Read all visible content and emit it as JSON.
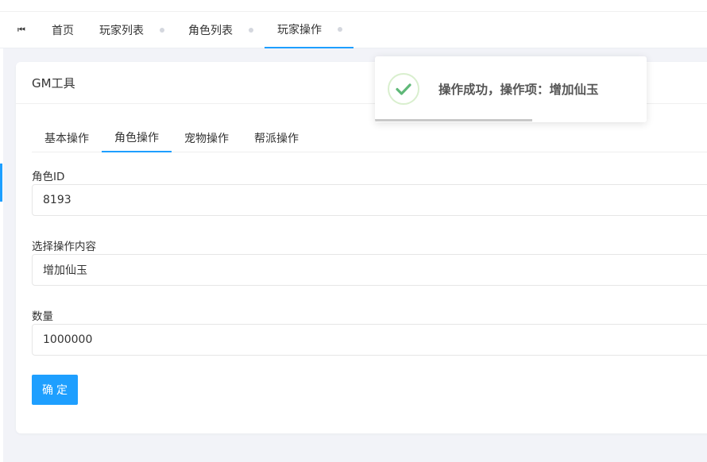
{
  "nav": {
    "first_icon": "⏮",
    "tabs": [
      {
        "label": "首页",
        "closable": false
      },
      {
        "label": "玩家列表",
        "closable": true
      },
      {
        "label": "角色列表",
        "closable": true
      },
      {
        "label": "玩家操作",
        "closable": true,
        "active": true
      }
    ]
  },
  "card": {
    "title": "GM工具",
    "subtabs": [
      "基本操作",
      "角色操作",
      "宠物操作",
      "帮派操作"
    ],
    "active_subtab": 1
  },
  "form": {
    "role_id_label": "角色ID",
    "role_id_value": "8193",
    "action_label": "选择操作内容",
    "action_value": "增加仙玉",
    "amount_label": "数量",
    "amount_value": "1000000",
    "confirm_label": "确定"
  },
  "toast": {
    "message": "操作成功，操作项：增加仙玉",
    "progress": 0.58
  },
  "colors": {
    "accent": "#1e9fff",
    "success": "#5fb878",
    "background": "#f2f3f8"
  }
}
